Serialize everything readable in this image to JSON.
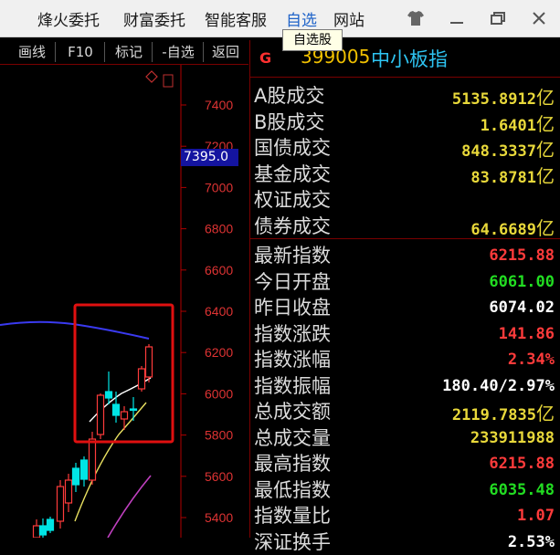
{
  "menu": {
    "items": [
      "烽火委托",
      "财富委托",
      "智能客服",
      "自选",
      "网站"
    ],
    "active_index": 3,
    "tooltip": "自选股"
  },
  "toolbar": {
    "buttons": [
      "画线",
      "F10",
      "标记",
      "-自选",
      "返回"
    ]
  },
  "chart": {
    "price_flag": "7395.0",
    "y_ticks": [
      "7400",
      "7200",
      "7000",
      "6800",
      "6600",
      "6400",
      "6200",
      "6000",
      "5800",
      "5600",
      "5400"
    ],
    "up_color": "#ff3b3b",
    "down_color": "#00e5e5"
  },
  "panel": {
    "code": "399005",
    "name": "中小板指",
    "colors": {
      "yellow": "#e8d83a",
      "red": "#ff3b3b",
      "green": "#22dd22",
      "white": "#ffffff"
    },
    "section1": [
      {
        "label": "A股成交",
        "value": "5135.8912",
        "unit": "亿",
        "color": "yellow"
      },
      {
        "label": "B股成交",
        "value": "1.6401",
        "unit": "亿",
        "color": "yellow"
      },
      {
        "label": "国债成交",
        "value": "848.3337",
        "unit": "亿",
        "color": "yellow"
      },
      {
        "label": "基金成交",
        "value": "83.8781",
        "unit": "亿",
        "color": "yellow"
      },
      {
        "label": "权证成交",
        "value": "",
        "unit": "",
        "color": "yellow"
      },
      {
        "label": "债券成交",
        "value": "64.6689",
        "unit": "亿",
        "color": "yellow"
      }
    ],
    "section2": [
      {
        "label": "最新指数",
        "value": "6215.88",
        "unit": "",
        "color": "red"
      },
      {
        "label": "今日开盘",
        "value": "6061.00",
        "unit": "",
        "color": "green"
      },
      {
        "label": "昨日收盘",
        "value": "6074.02",
        "unit": "",
        "color": "white"
      },
      {
        "label": "指数涨跌",
        "value": "141.86",
        "unit": "",
        "color": "red"
      },
      {
        "label": "指数涨幅",
        "value": "2.34%",
        "unit": "",
        "color": "red"
      },
      {
        "label": "指数振幅",
        "value": "180.40/2.97%",
        "unit": "",
        "color": "white"
      },
      {
        "label": "总成交额",
        "value": "2119.7835",
        "unit": "亿",
        "color": "yellow"
      },
      {
        "label": "总成交量",
        "value": "233911988",
        "unit": "",
        "color": "yellow"
      },
      {
        "label": "最高指数",
        "value": "6215.88",
        "unit": "",
        "color": "red"
      },
      {
        "label": "最低指数",
        "value": "6035.48",
        "unit": "",
        "color": "green"
      },
      {
        "label": "指数量比",
        "value": "1.07",
        "unit": "",
        "color": "red"
      },
      {
        "label": "深证换手",
        "value": "2.53%",
        "unit": "",
        "color": "white"
      }
    ]
  }
}
